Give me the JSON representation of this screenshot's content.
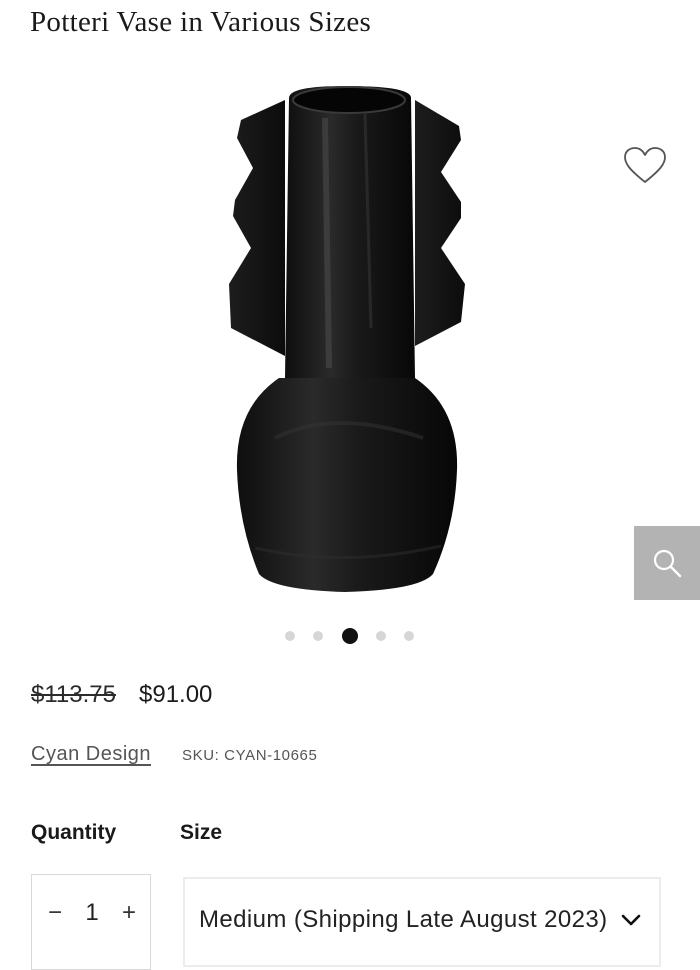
{
  "product": {
    "title": "Potteri Vase in Various Sizes",
    "price_original": "$113.75",
    "price_sale": "$91.00",
    "brand": "Cyan Design",
    "sku": "SKU: CYAN-10665"
  },
  "gallery": {
    "image_alt": "Black ceramic vase with jagged side fins",
    "dots_count": 5,
    "active_dot_index": 2,
    "icons": {
      "wishlist": "heart-outline-icon",
      "zoom": "magnifier-icon"
    }
  },
  "options": {
    "quantity_label": "Quantity",
    "quantity_value": "1",
    "minus_glyph": "−",
    "plus_glyph": "+",
    "size_label": "Size",
    "size_value": "Medium (Shipping Late August 2023)"
  },
  "colors": {
    "text": "#1a1a1a",
    "muted": "#555555",
    "zoom_button_bg": "#b3b3b3",
    "dot_active": "#111111",
    "dot_inactive": "#d6d6d6"
  }
}
